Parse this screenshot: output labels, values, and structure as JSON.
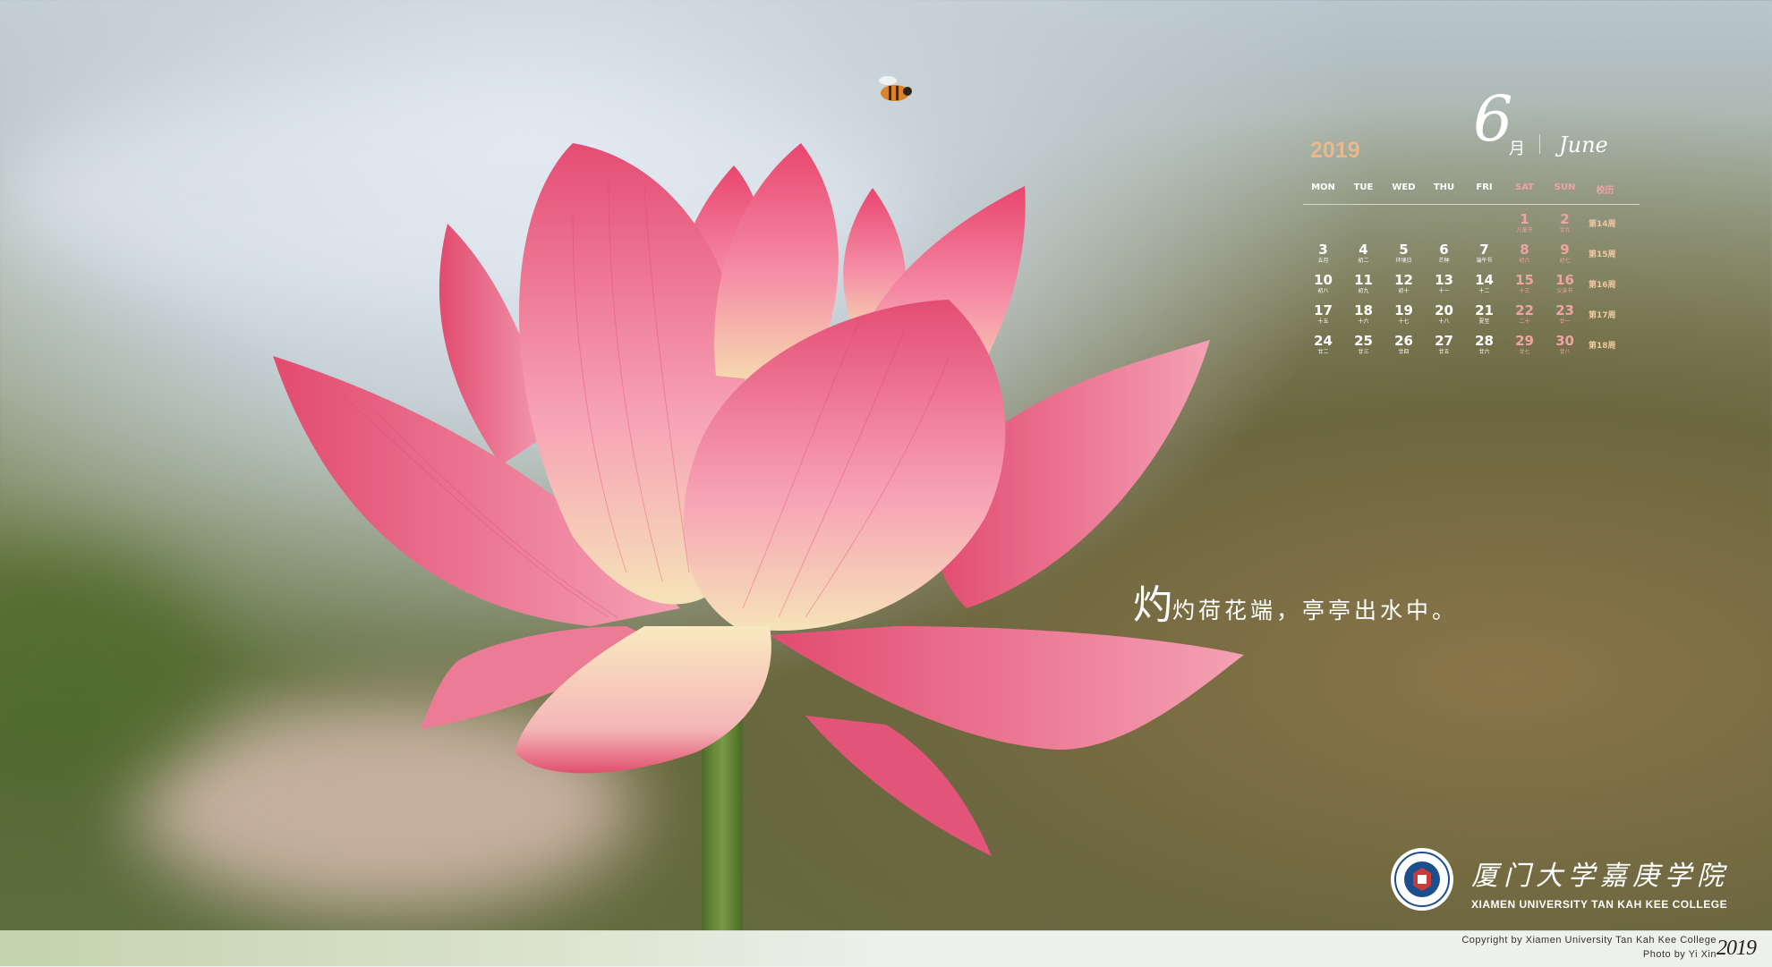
{
  "calendar": {
    "year": "2019",
    "month_num": "6",
    "month_zh": "月",
    "month_en": "June",
    "headers": [
      "MON",
      "TUE",
      "WED",
      "THU",
      "FRI",
      "SAT",
      "SUN",
      "校历"
    ],
    "rows": [
      {
        "cells": [
          null,
          null,
          null,
          null,
          null,
          {
            "d": "1",
            "s": "儿童节"
          },
          {
            "d": "2",
            "s": "廿九"
          }
        ],
        "week": "第14周"
      },
      {
        "cells": [
          {
            "d": "3",
            "s": "五月"
          },
          {
            "d": "4",
            "s": "初二"
          },
          {
            "d": "5",
            "s": "环境日"
          },
          {
            "d": "6",
            "s": "芒种"
          },
          {
            "d": "7",
            "s": "端午节"
          },
          {
            "d": "8",
            "s": "初六"
          },
          {
            "d": "9",
            "s": "初七"
          }
        ],
        "week": "第15周"
      },
      {
        "cells": [
          {
            "d": "10",
            "s": "初八"
          },
          {
            "d": "11",
            "s": "初九"
          },
          {
            "d": "12",
            "s": "初十"
          },
          {
            "d": "13",
            "s": "十一"
          },
          {
            "d": "14",
            "s": "十二"
          },
          {
            "d": "15",
            "s": "十三"
          },
          {
            "d": "16",
            "s": "父亲节"
          }
        ],
        "week": "第16周"
      },
      {
        "cells": [
          {
            "d": "17",
            "s": "十五"
          },
          {
            "d": "18",
            "s": "十六"
          },
          {
            "d": "19",
            "s": "十七"
          },
          {
            "d": "20",
            "s": "十八"
          },
          {
            "d": "21",
            "s": "夏至"
          },
          {
            "d": "22",
            "s": "二十"
          },
          {
            "d": "23",
            "s": "廿一"
          }
        ],
        "week": "第17周"
      },
      {
        "cells": [
          {
            "d": "24",
            "s": "廿二"
          },
          {
            "d": "25",
            "s": "廿三"
          },
          {
            "d": "26",
            "s": "廿四"
          },
          {
            "d": "27",
            "s": "廿五"
          },
          {
            "d": "28",
            "s": "廿六"
          },
          {
            "d": "29",
            "s": "廿七"
          },
          {
            "d": "30",
            "s": "廿八"
          }
        ],
        "week": "第18周"
      }
    ]
  },
  "poem": {
    "big_char": "灼",
    "rest": "灼荷花端，亭亭出水中。"
  },
  "college": {
    "name_zh": "厦门大学嘉庚学院",
    "name_en": "XIAMEN UNIVERSITY TAN KAH KEE COLLEGE"
  },
  "footer": {
    "copyright": "Copyright  by  Xiamen  University  Tan  Kah  Kee  College",
    "photo_credit": "Photo  by  Yi  Xin",
    "year": "2019"
  },
  "colors": {
    "petal_pink": "#e8577a",
    "petal_light": "#f6a0b4",
    "petal_base": "#f7e6b5",
    "year_accent": "#e9b98c",
    "weekend": "#f0a3a6"
  }
}
